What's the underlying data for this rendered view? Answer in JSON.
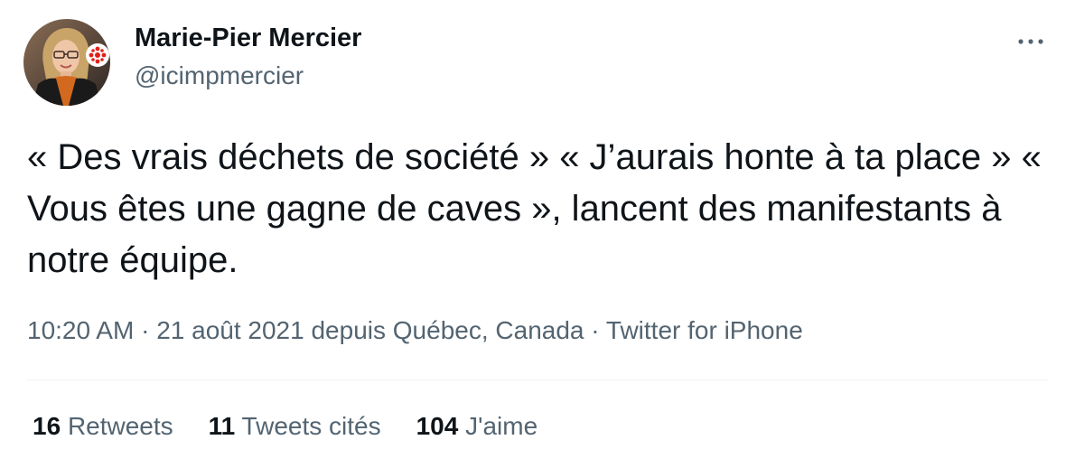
{
  "author": {
    "name": "Marie-Pier Mercier",
    "handle": "@icimpmercier",
    "avatar_icon": "profile-photo-with-radio-canada-logo",
    "brand_color": "#e32119"
  },
  "more_icon": "ellipsis-icon",
  "tweet": {
    "text": "« Des vrais déchets de société » « J’aurais honte à ta place » « Vous êtes une gagne de caves », lancent des manifestants à notre équipe."
  },
  "meta": {
    "time": "10:20 AM",
    "separator": " · ",
    "date": "21 août 2021",
    "location_prefix": " depuis ",
    "location": "Québec, Canada",
    "source": "Twitter for iPhone"
  },
  "stats": {
    "retweets": {
      "count": "16",
      "label": "Retweets"
    },
    "quotes": {
      "count": "11",
      "label": "Tweets cités"
    },
    "likes": {
      "count": "104",
      "label": "J'aime"
    }
  },
  "colors": {
    "text_primary": "#0f1419",
    "text_secondary": "#536471",
    "divider": "#eff3f4"
  }
}
